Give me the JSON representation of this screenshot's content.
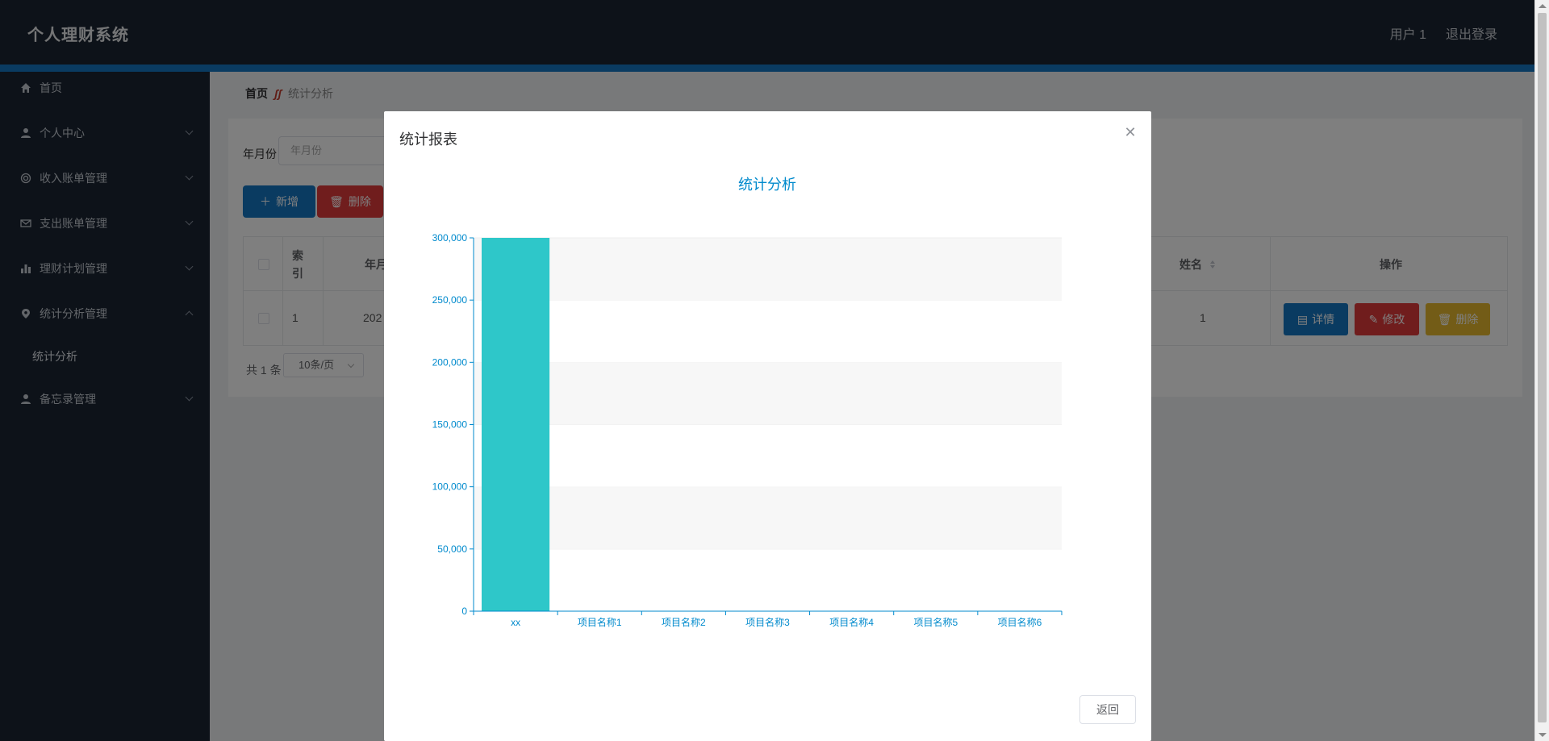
{
  "header": {
    "brand": "个人理财系统",
    "user": "用户 1",
    "logout": "退出登录"
  },
  "sidebar": {
    "items": [
      {
        "label": "首页",
        "icon": "home-icon"
      },
      {
        "label": "个人中心",
        "icon": "user-icon"
      },
      {
        "label": "收入账单管理",
        "icon": "circle-icon"
      },
      {
        "label": "支出账单管理",
        "icon": "mail-icon"
      },
      {
        "label": "理财计划管理",
        "icon": "bar-chart-icon"
      },
      {
        "label": "统计分析管理",
        "icon": "location-icon"
      },
      {
        "label": "备忘录管理",
        "icon": "user-icon"
      }
    ],
    "submenu": {
      "label": "统计分析"
    }
  },
  "breadcrumb": {
    "home": "首页",
    "current": "统计分析"
  },
  "search": {
    "label": "年月份",
    "placeholder": "年月份"
  },
  "toolbar": {
    "add_label": "新增",
    "delete_label": "删除"
  },
  "table": {
    "headers": {
      "index": "索\n引",
      "yearmonth": "年月",
      "name": "姓名",
      "actions": "操作"
    },
    "rows": [
      {
        "index": "1",
        "yearmonth": "202",
        "name": "1"
      }
    ],
    "row_buttons": {
      "detail": "详情",
      "edit": "修改",
      "delete": "删除"
    }
  },
  "pager": {
    "total": "共 1 条",
    "page_size": "10条/页"
  },
  "modal": {
    "title": "统计报表",
    "close_icon": "close-icon",
    "back_label": "返回"
  },
  "colors": {
    "header_bg": "#1b2533",
    "accent": "#1576c3",
    "danger": "#e03b3b",
    "warning": "#e6b82e",
    "bar": "#2ec7c9",
    "axis": "#008acd"
  },
  "chart_data": {
    "type": "bar",
    "title": "统计分析",
    "categories": [
      "xx",
      "项目名称1",
      "项目名称2",
      "项目名称3",
      "项目名称4",
      "项目名称5",
      "项目名称6"
    ],
    "values": [
      300000,
      0,
      0,
      0,
      0,
      0,
      0
    ],
    "y_ticks": [
      "0",
      "50,000",
      "100,000",
      "150,000",
      "200,000",
      "250,000",
      "300,000"
    ],
    "ylim": [
      0,
      300000
    ],
    "grid": true
  }
}
